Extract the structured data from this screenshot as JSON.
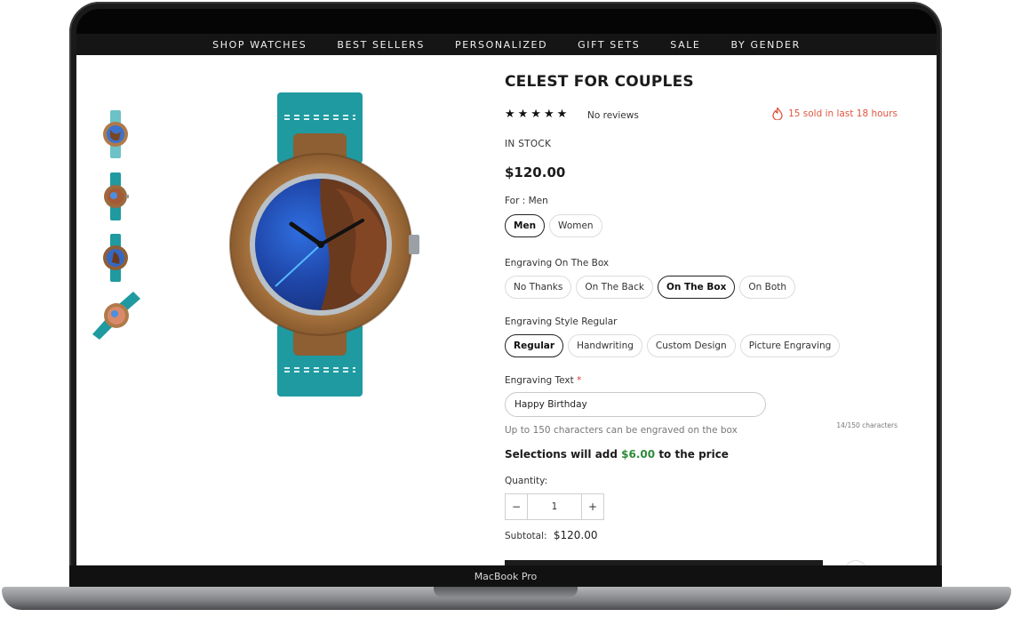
{
  "device": {
    "label": "MacBook Pro"
  },
  "nav": {
    "items": [
      "SHOP WATCHES",
      "BEST SELLERS",
      "PERSONALIZED",
      "GIFT SETS",
      "SALE",
      "BY GENDER"
    ]
  },
  "product": {
    "title": "CELEST FOR COUPLES",
    "stars": "★★★★★",
    "reviews": "No reviews",
    "sold": "15 sold in last 18 hours",
    "stock": "IN STOCK",
    "price": "$120.00"
  },
  "for": {
    "label": "For : Men",
    "options": [
      "Men",
      "Women"
    ],
    "selected": "Men"
  },
  "engraving_box": {
    "label": "Engraving On The Box",
    "options": [
      "No Thanks",
      "On The Back",
      "On The Box",
      "On Both"
    ],
    "selected": "On The Box"
  },
  "engraving_style": {
    "label": "Engraving Style Regular",
    "options": [
      "Regular",
      "Handwriting",
      "Custom Design",
      "Picture Engraving"
    ],
    "selected": "Regular"
  },
  "engraving_text": {
    "label": "Engraving Text",
    "required_mark": "*",
    "value": "Happy Birthday",
    "counter": "14/150 characters",
    "hint": "Up to 150 characters can be engraved on the box"
  },
  "selections": {
    "prefix": "Selections will add ",
    "amount": "$6.00",
    "suffix": " to the price"
  },
  "quantity": {
    "label": "Quantity:",
    "minus": "−",
    "value": "1",
    "plus": "+"
  },
  "subtotal": {
    "label": "Subtotal:",
    "value": "$120.00"
  },
  "colors": {
    "accent_green": "#2e8b3a",
    "sold_red": "#e0553f",
    "strap_teal": "#1e9aa0"
  }
}
